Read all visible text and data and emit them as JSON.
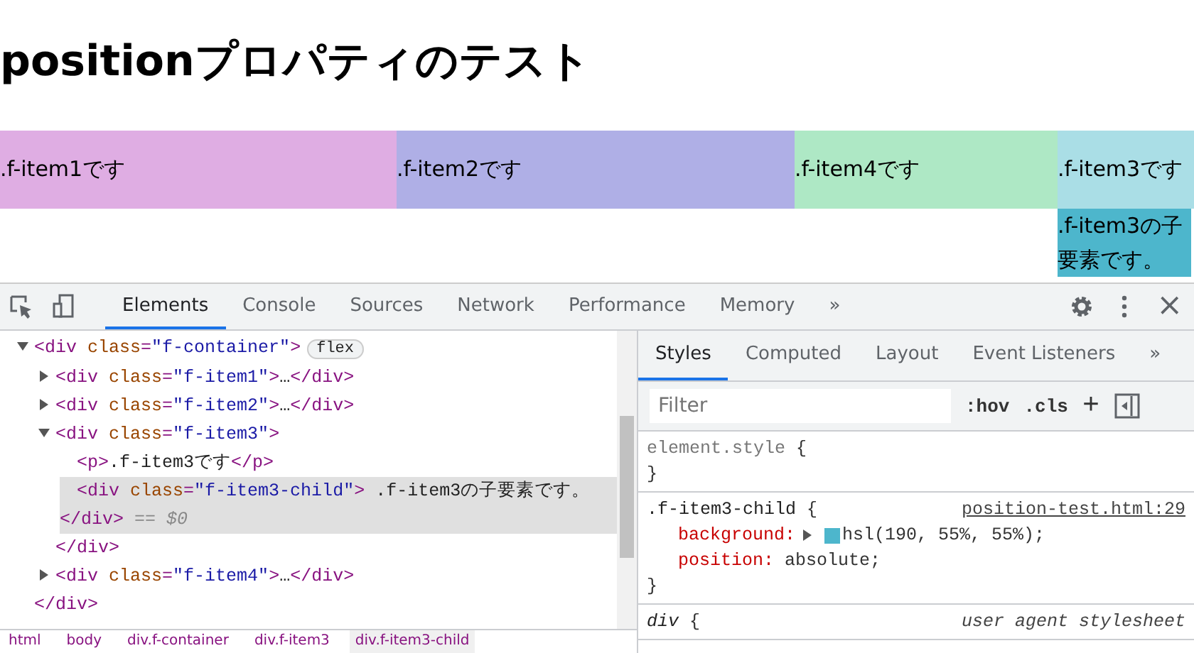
{
  "page": {
    "heading": "positionプロパティのテスト",
    "flex_items": [
      {
        "label": ".f-item1です",
        "color": "#dfade3"
      },
      {
        "label": ".f-item2です",
        "color": "#afafe6"
      },
      {
        "label": ".f-item4です",
        "color": "#aee8c5"
      },
      {
        "label": ".f-item3です",
        "color": "#aadee6",
        "child": {
          "label": ".f-item3の子要素です。",
          "color": "#4db6cc"
        }
      }
    ]
  },
  "devtools": {
    "tabs": [
      {
        "label": "Elements",
        "selected": true
      },
      {
        "label": "Console",
        "selected": false
      },
      {
        "label": "Sources",
        "selected": false
      },
      {
        "label": "Network",
        "selected": false
      },
      {
        "label": "Performance",
        "selected": false
      },
      {
        "label": "Memory",
        "selected": false
      }
    ],
    "more_tabs": "»",
    "close": "×",
    "tree": [
      {
        "expanded": true,
        "selected": false,
        "badge": "flex",
        "open": [
          {
            "kind": "tag",
            "s": "<div "
          },
          {
            "kind": "attr",
            "s": "class"
          },
          {
            "kind": "tag",
            "s": "="
          },
          {
            "kind": "val",
            "s": "\"f-container\""
          },
          {
            "kind": "tag",
            "s": ">"
          }
        ],
        "close": [
          {
            "kind": "tag",
            "s": "</div>"
          }
        ],
        "children": [
          {
            "expanded": false,
            "selected": false,
            "open": [
              {
                "kind": "tag",
                "s": "<div "
              },
              {
                "kind": "attr",
                "s": "class"
              },
              {
                "kind": "tag",
                "s": "="
              },
              {
                "kind": "val",
                "s": "\"f-item1\""
              },
              {
                "kind": "tag",
                "s": ">"
              },
              {
                "kind": "text",
                "s": "…"
              },
              {
                "kind": "tag",
                "s": "</div>"
              }
            ]
          },
          {
            "expanded": false,
            "selected": false,
            "open": [
              {
                "kind": "tag",
                "s": "<div "
              },
              {
                "kind": "attr",
                "s": "class"
              },
              {
                "kind": "tag",
                "s": "="
              },
              {
                "kind": "val",
                "s": "\"f-item2\""
              },
              {
                "kind": "tag",
                "s": ">"
              },
              {
                "kind": "text",
                "s": "…"
              },
              {
                "kind": "tag",
                "s": "</div>"
              }
            ]
          },
          {
            "expanded": true,
            "selected": false,
            "open": [
              {
                "kind": "tag",
                "s": "<div "
              },
              {
                "kind": "attr",
                "s": "class"
              },
              {
                "kind": "tag",
                "s": "="
              },
              {
                "kind": "val",
                "s": "\"f-item3\""
              },
              {
                "kind": "tag",
                "s": ">"
              }
            ],
            "close": [
              {
                "kind": "tag",
                "s": "</div>"
              }
            ],
            "children": [
              {
                "selected": false,
                "open": [
                  {
                    "kind": "tag",
                    "s": "<p>"
                  },
                  {
                    "kind": "text",
                    "s": ".f-item3です"
                  },
                  {
                    "kind": "tag",
                    "s": "</p>"
                  }
                ]
              },
              {
                "selected": true,
                "open": [
                  {
                    "kind": "tag",
                    "s": "<div "
                  },
                  {
                    "kind": "attr",
                    "s": "class"
                  },
                  {
                    "kind": "tag",
                    "s": "="
                  },
                  {
                    "kind": "val",
                    "s": "\"f-item3-child\""
                  },
                  {
                    "kind": "tag",
                    "s": ">"
                  },
                  {
                    "kind": "text",
                    "s": " .f-item3の子要素です。 "
                  },
                  {
                    "kind": "tag",
                    "s": "</div>"
                  },
                  {
                    "kind": "ref",
                    "s": " == $0"
                  }
                ]
              }
            ]
          },
          {
            "expanded": false,
            "selected": false,
            "open": [
              {
                "kind": "tag",
                "s": "<div "
              },
              {
                "kind": "attr",
                "s": "class"
              },
              {
                "kind": "tag",
                "s": "="
              },
              {
                "kind": "val",
                "s": "\"f-item4\""
              },
              {
                "kind": "tag",
                "s": ">"
              },
              {
                "kind": "text",
                "s": "…"
              },
              {
                "kind": "tag",
                "s": "</div>"
              }
            ]
          }
        ]
      }
    ],
    "breadcrumbs": [
      {
        "label": "html",
        "selected": false
      },
      {
        "label": "body",
        "selected": false
      },
      {
        "label": "div.f-container",
        "selected": false
      },
      {
        "label": "div.f-item3",
        "selected": false
      },
      {
        "label": "div.f-item3-child",
        "selected": true
      }
    ],
    "sub_tabs": [
      {
        "label": "Styles",
        "selected": true
      },
      {
        "label": "Computed",
        "selected": false
      },
      {
        "label": "Layout",
        "selected": false
      },
      {
        "label": "Event Listeners",
        "selected": false
      }
    ],
    "sub_more": "»",
    "filter": {
      "placeholder": "Filter"
    },
    "hov": ":hov",
    "cls": ".cls",
    "plus": "+",
    "rules": [
      {
        "kind": "inline",
        "selector": "element.style",
        "open": "{",
        "close": "}"
      },
      {
        "kind": "author",
        "selector": ".f-item3-child",
        "open": "{",
        "close": "}",
        "source": "position-test.html:29",
        "declarations": [
          {
            "prop": "background",
            "colon": ":",
            "value": "hsl(190, 55%, 55%);",
            "color": "#4db6cc"
          },
          {
            "prop": "position",
            "colon": ":",
            "value": " absolute;"
          }
        ]
      },
      {
        "kind": "ua",
        "selector": "div",
        "open": "{",
        "source": "user agent stylesheet"
      }
    ]
  }
}
